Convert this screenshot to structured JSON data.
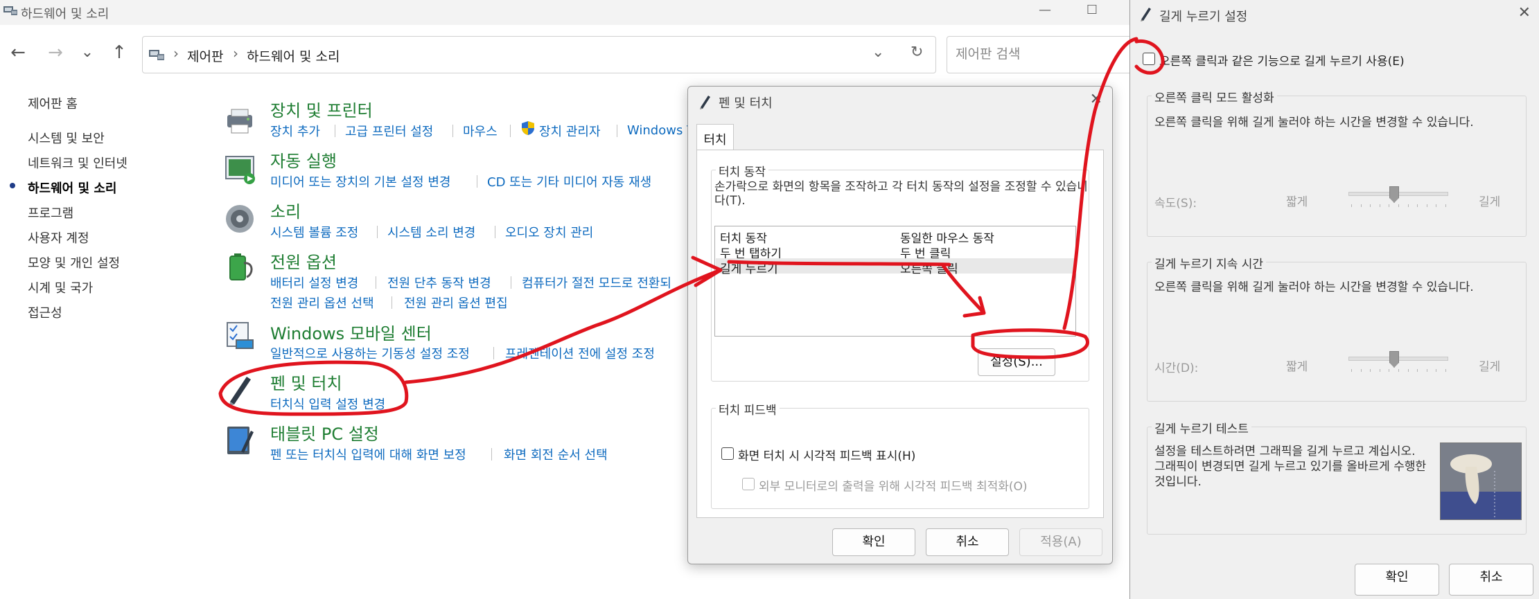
{
  "window": {
    "title": "하드웨어 및 소리",
    "minimize": "—",
    "maximize": "☐"
  },
  "nav": {
    "back": "←",
    "forward": "→",
    "recent": "⌄",
    "up": "↑",
    "breadcrumb": [
      "제어판",
      "하드웨어 및 소리"
    ],
    "dropdown": "⌄",
    "refresh": "↻",
    "search_placeholder": "제어판 검색"
  },
  "sidebar": {
    "items": [
      {
        "label": "제어판 홈"
      },
      {
        "label": "시스템 및 보안"
      },
      {
        "label": "네트워크 및 인터넷"
      },
      {
        "label": "하드웨어 및 소리",
        "active": true
      },
      {
        "label": "프로그램"
      },
      {
        "label": "사용자 계정"
      },
      {
        "label": "모양 및 개인 설정"
      },
      {
        "label": "시계 및 국가"
      },
      {
        "label": "접근성"
      }
    ]
  },
  "categories": [
    {
      "title": "장치 및 프린터",
      "links": [
        [
          "장치 추가",
          "고급 프린터 설정",
          "마우스",
          "장치 관리자",
          "Windows T"
        ]
      ],
      "icon": "printer-icon"
    },
    {
      "title": "자동 실행",
      "links": [
        [
          "미디어 또는 장치의 기본 설정 변경",
          "CD 또는 기타 미디어 자동 재생"
        ]
      ],
      "icon": "autoplay-icon"
    },
    {
      "title": "소리",
      "links": [
        [
          "시스템 볼륨 조정",
          "시스템 소리 변경",
          "오디오 장치 관리"
        ]
      ],
      "icon": "speaker-icon"
    },
    {
      "title": "전원 옵션",
      "links": [
        [
          "배터리 설정 변경",
          "전원 단추 동작 변경",
          "컴퓨터가 절전 모드로 전환되"
        ],
        [
          "전원 관리 옵션 선택",
          "전원 관리 옵션 편집"
        ]
      ],
      "icon": "power-icon"
    },
    {
      "title": "Windows 모바일 센터",
      "links": [
        [
          "일반적으로 사용하는 기동성 설정 조정",
          "프레젠테이션 전에 설정 조정"
        ]
      ],
      "icon": "mobility-center-icon"
    },
    {
      "title": "펜 및 터치",
      "links": [
        [
          "터치식 입력 설정 변경"
        ]
      ],
      "icon": "pen-icon"
    },
    {
      "title": "태블릿 PC 설정",
      "links": [
        [
          "펜 또는 터치식 입력에 대해 화면 보정",
          "화면 회전 순서 선택"
        ]
      ],
      "icon": "tablet-icon"
    }
  ],
  "pen_dialog": {
    "title": "펜 및 터치",
    "tab": "터치",
    "touch_actions_group": "터치 동작",
    "touch_actions_desc": "손가락으로 화면의 항목을 조작하고 각 터치 동작의 설정을 조정할 수 있습니다(T).",
    "list_rows": [
      [
        "터치 동작",
        "동일한 마우스 동작"
      ],
      [
        "두 번 탭하기",
        "두 번 클릭"
      ],
      [
        "길게 누르기",
        "오른쪽 클릭"
      ]
    ],
    "settings_button": "설정(S)...",
    "feedback_group": "터치 피드백",
    "feedback_check": "화면 터치 시 시각적 피드백 표시(H)",
    "feedback_sub_check": "외부 모니터로의 출력을 위해 시각적 피드백 최적화(O)",
    "ok": "확인",
    "cancel": "취소",
    "apply": "적용(A)"
  },
  "hold_dialog": {
    "title": "길게 누르기 설정",
    "enable_check": "오른쪽 클릭과 같은 기능으로 길게 누르기 사용(E)",
    "mode_group": "오른쪽 클릭 모드 활성화",
    "mode_desc": "오른쪽 클릭을 위해 길게 눌러야 하는 시간을 변경할 수 있습니다.",
    "speed_label": "속도(S):",
    "speed_short": "짧게",
    "speed_long": "길게",
    "speed_value_fraction": 0.45,
    "duration_group": "길게 누르기 지속 시간",
    "duration_desc": "오른쪽 클릭을 위해 길게 눌러야 하는 시간을 변경할 수 있습니다.",
    "duration_label": "시간(D):",
    "duration_short": "짧게",
    "duration_long": "길게",
    "duration_value_fraction": 0.45,
    "test_group": "길게 누르기 테스트",
    "test_desc": "설정을 테스트하려면 그래픽을 길게 누르고 계십시오. 그래픽이 변경되면 길게 누르고 있기를 올바르게 수행한 것입니다.",
    "ok": "확인",
    "cancel": "취소"
  },
  "annotation_color": "#e0141e"
}
